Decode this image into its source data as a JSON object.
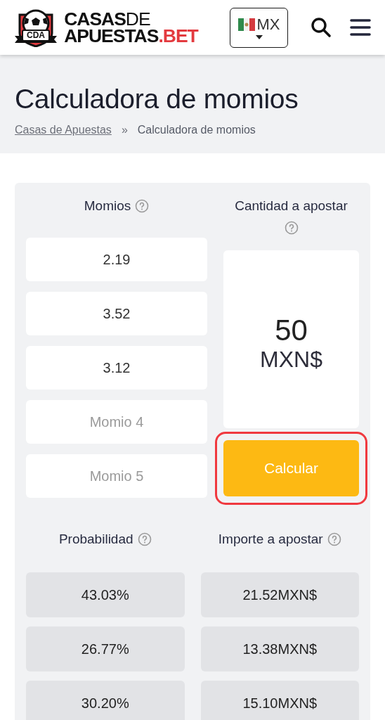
{
  "header": {
    "logo": {
      "badge": "CDA",
      "line1_bold": "CASAS",
      "line1_light": "DE",
      "line2": "APUESTAS",
      "line2_accent": ".BET"
    },
    "country": {
      "code": "MX"
    }
  },
  "page": {
    "title": "Calculadora de momios",
    "breadcrumb": {
      "link": "Casas de Apuestas",
      "separator": "»",
      "current": "Calculadora de momios"
    }
  },
  "calculator": {
    "odds_label": "Momios",
    "stake_label": "Cantidad a apostar",
    "odds": [
      {
        "value": "2.19"
      },
      {
        "value": "3.52"
      },
      {
        "value": "3.12"
      },
      {
        "placeholder": "Momio 4"
      },
      {
        "placeholder": "Momio 5"
      }
    ],
    "stake": {
      "value": "50",
      "currency": "MXN$"
    },
    "button": {
      "label": "Calcular",
      "highlighted": true
    },
    "probability_label": "Probabilidad",
    "amount_label": "Importe a apostar",
    "results": [
      {
        "probability": "43.03%",
        "amount": "21.52MXN$"
      },
      {
        "probability": "26.77%",
        "amount": "13.38MXN$"
      },
      {
        "probability": "30.20%",
        "amount": "15.10MXN$"
      }
    ]
  }
}
